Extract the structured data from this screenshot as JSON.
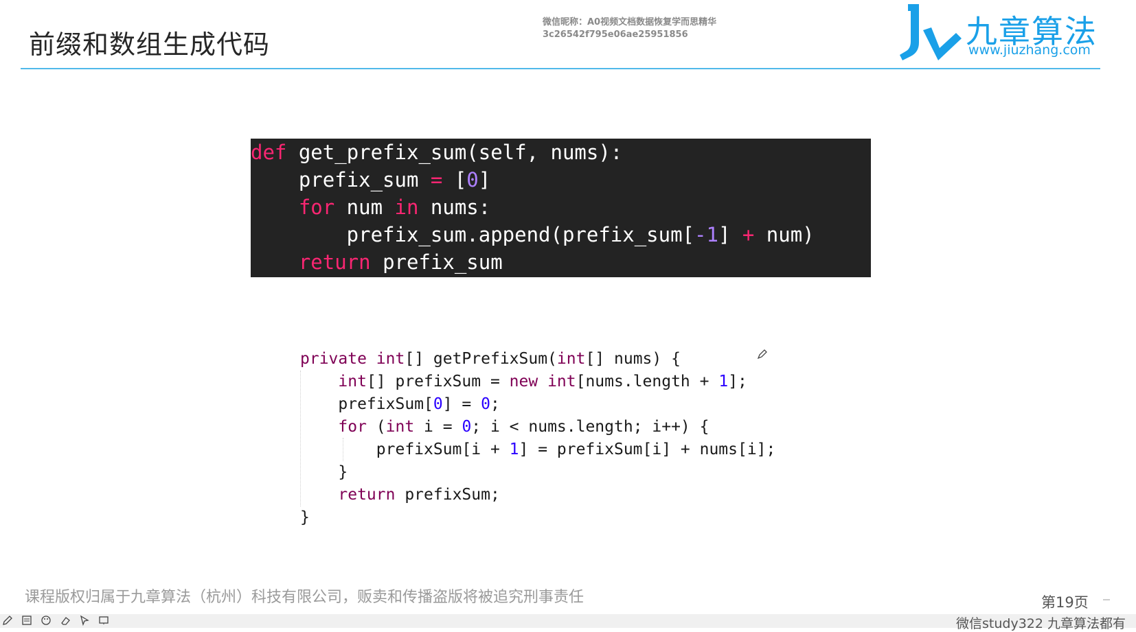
{
  "slide": {
    "title": "前缀和数组生成代码",
    "watermark_line1": "微信昵称：A0视频文档数据恢复学而思精华",
    "watermark_line2": "3c26542f795e06ae25951856",
    "logo_name": "九章算法",
    "logo_url": "www.jiuzhang.com",
    "footer": "课程版权归属于九章算法（杭州）科技有限公司，贩卖和传播盗版将被追究刑事责任",
    "page_number": "第19页",
    "bottom_watermark": "微信study322 九章算法都有"
  },
  "python_code": {
    "line1_kw": "def",
    "line1_rest": " get_prefix_sum(self, nums):",
    "line2_a": "    prefix_sum ",
    "line2_op": "=",
    "line2_b": " [",
    "line2_num": "0",
    "line2_c": "]",
    "line3_kw1": "    for",
    "line3_a": " num ",
    "line3_kw2": "in",
    "line3_b": " nums:",
    "line4_a": "        prefix_sum.append(prefix_sum[",
    "line4_num": "-1",
    "line4_b": "] ",
    "line4_op": "+",
    "line4_c": " num)",
    "line5_kw": "    return",
    "line5_rest": " prefix_sum"
  },
  "java_code": {
    "l1_kw1": "private",
    "l1_sp": " ",
    "l1_kw2": "int",
    "l1_a": "[] getPrefixSum(",
    "l1_kw3": "int",
    "l1_b": "[] nums) {",
    "l2_kw1": "    int",
    "l2_a": "[] prefixSum = ",
    "l2_kw2": "new",
    "l2_sp": " ",
    "l2_kw3": "int",
    "l2_b": "[nums.length + ",
    "l2_num": "1",
    "l2_c": "];",
    "l3_a": "    prefixSum[",
    "l3_num1": "0",
    "l3_b": "] = ",
    "l3_num2": "0",
    "l3_c": ";",
    "l4_kw1": "    for",
    "l4_a": " (",
    "l4_kw2": "int",
    "l4_b": " i = ",
    "l4_num": "0",
    "l4_c": "; i < nums.length; i++) {",
    "l5_a": "        prefixSum[i + ",
    "l5_num": "1",
    "l5_b": "] = prefixSum[i] + nums[i];",
    "l6": "    }",
    "l7_kw": "    return",
    "l7_a": " prefixSum;",
    "l8": "}"
  },
  "colors": {
    "accent": "#1aa0e8",
    "rule": "#4fb9ea",
    "code_bg": "#232323",
    "py_keyword": "#f92672",
    "py_number": "#ae81ff",
    "java_keyword": "#7f0055",
    "java_number": "#2a00ff"
  },
  "toolbar_icons": [
    "pen-icon",
    "notes-icon",
    "palette-icon",
    "eraser-icon",
    "pointer-icon",
    "screen-icon"
  ]
}
